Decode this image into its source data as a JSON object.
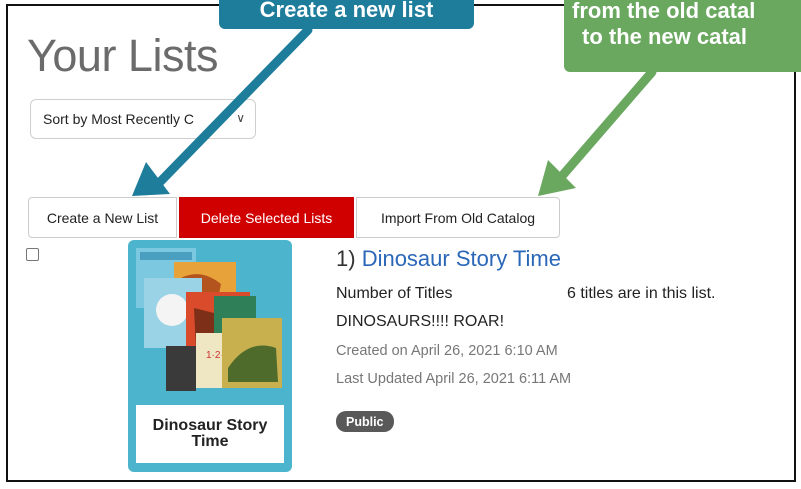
{
  "page": {
    "title": "Your Lists",
    "sort_select_value": "Sort by Most Recently C"
  },
  "toolbar": {
    "create_label": "Create a New List",
    "delete_label": "Delete Selected Lists",
    "import_label": "Import From Old Catalog"
  },
  "list_item": {
    "index": "1)",
    "name": "Dinosaur Story Time",
    "cover_title_line1": "Dinosaur Story",
    "cover_title_line2": "Time",
    "number_of_titles_label": "Number of Titles",
    "number_of_titles_value": "6 titles are in this list.",
    "description": "DINOSAURS!!!! ROAR!",
    "created": "Created on April 26, 2021 6:10 AM",
    "updated": "Last Updated April 26, 2021 6:11 AM",
    "visibility": "Public"
  },
  "callouts": {
    "blue_text": "Create a new list",
    "green_line1": "from the old catal",
    "green_line2": "to the new catal"
  },
  "colors": {
    "link": "#2a67b8",
    "delete": "#d10000",
    "callout_blue": "#1f7d9c",
    "callout_green": "#6aa860",
    "cover_bg": "#4cb4cc"
  }
}
